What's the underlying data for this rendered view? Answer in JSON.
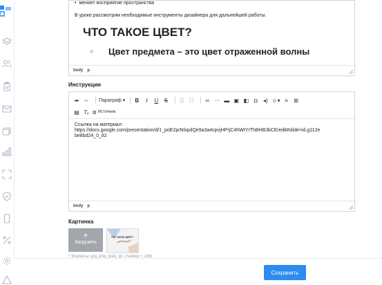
{
  "upper_editor": {
    "bullet_text": "меняет восприятие пространства",
    "intro_text": "В уроке рассмотрим необходимые инструменты дизайнера для дальнейшей работы.",
    "heading": "ЧТО ТАКОЕ ЦВЕТ?",
    "subheading": "Цвет предмета – это цвет отраженной волны",
    "status_path": [
      "body",
      "p"
    ]
  },
  "instructions": {
    "title": "Инструкции",
    "toolbar": {
      "format_label": "Параграф",
      "source_label": "Источник"
    },
    "content_line1": "Ссылка на материал:",
    "content_line2": "https://docs.google.com/presentation/d/1_poE2prNlxpdQe9a3a4cpvjHPrjC4hWtYrThBHBJbCE/edit#slide=id.g112e",
    "content_line3": "be8bd24_0_82",
    "status_path": [
      "body",
      "p"
    ]
  },
  "picture": {
    "title": "Картинка",
    "upload_label": "Загрузить",
    "thumb_text": "ЧТО ТАКОЕ ЦВЕТ?",
    "hint": "* Форматы: jpg, png, jpeg, gif. Размер < 1Mb"
  },
  "footer": {
    "save_label": "Сохранить"
  },
  "colors": {
    "accent": "#2d8cf0",
    "sidebar_icon": "#aeb8c6"
  },
  "sidebar_icons": [
    "logo-icon",
    "layers-icon",
    "users-icon",
    "clipboard-icon",
    "mail-icon",
    "stack-icon",
    "bar-chart-icon",
    "expand-icon",
    "shield-icon",
    "mobile-icon",
    "percent-icon",
    "settings-icon",
    "warning-icon"
  ]
}
